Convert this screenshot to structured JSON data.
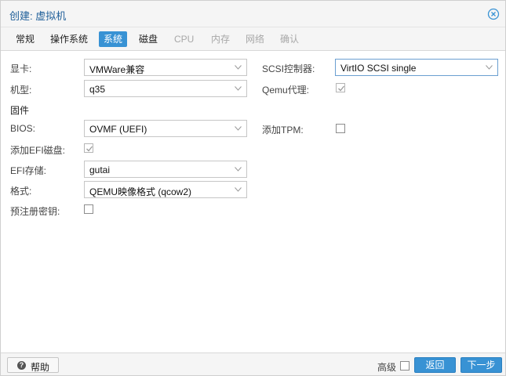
{
  "window": {
    "title": "创建: 虚拟机"
  },
  "tabs": [
    {
      "label": "常规",
      "state": "normal"
    },
    {
      "label": "操作系统",
      "state": "normal"
    },
    {
      "label": "系统",
      "state": "active"
    },
    {
      "label": "磁盘",
      "state": "normal"
    },
    {
      "label": "CPU",
      "state": "disabled"
    },
    {
      "label": "内存",
      "state": "disabled"
    },
    {
      "label": "网络",
      "state": "disabled"
    },
    {
      "label": "确认",
      "state": "disabled"
    }
  ],
  "form": {
    "graphics": {
      "label": "显卡:",
      "value": "VMWare兼容"
    },
    "scsi": {
      "label": "SCSI控制器:",
      "value": "VirtIO SCSI single"
    },
    "machine": {
      "label": "机型:",
      "value": "q35"
    },
    "qemu_agent": {
      "label": "Qemu代理:",
      "checked": true
    },
    "firmware_section": "固件",
    "bios": {
      "label": "BIOS:",
      "value": "OVMF (UEFI)"
    },
    "tpm": {
      "label": "添加TPM:",
      "checked": false
    },
    "efi_disk": {
      "label": "添加EFI磁盘:",
      "checked": true
    },
    "efi_storage": {
      "label": "EFI存储:",
      "value": "gutai"
    },
    "format": {
      "label": "格式:",
      "value": "QEMU映像格式 (qcow2)"
    },
    "pre_enroll": {
      "label": "预注册密钥:",
      "checked": false
    }
  },
  "footer": {
    "help": "帮助",
    "advanced": {
      "label": "高级",
      "checked": false
    },
    "back": "返回",
    "next": "下一步"
  },
  "colors": {
    "accent": "#3892d4",
    "title": "#1f5f99"
  }
}
